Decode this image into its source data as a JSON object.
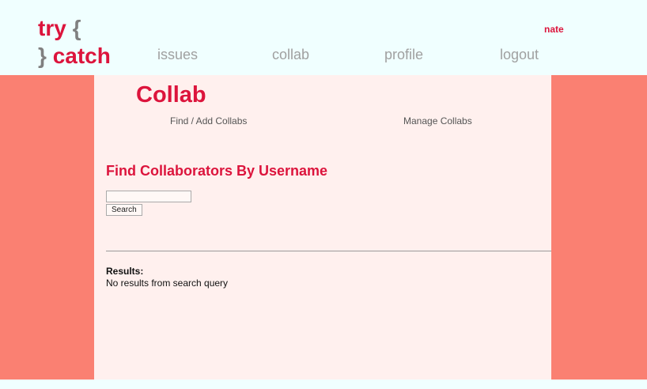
{
  "header": {
    "logo": {
      "word1": "try",
      "brace_open": "{",
      "brace_close": "}",
      "word2": "catch"
    },
    "nav": [
      {
        "label": "issues"
      },
      {
        "label": "collab"
      },
      {
        "label": "profile"
      },
      {
        "label": "logout"
      }
    ],
    "username": "nate"
  },
  "page": {
    "title": "Collab",
    "subnav": [
      {
        "label": "Find / Add Collabs"
      },
      {
        "label": "Manage Collabs"
      }
    ],
    "section_title": "Find Collaborators By Username",
    "search": {
      "value": "",
      "placeholder": "",
      "button_label": "Search"
    },
    "results": {
      "label": "Results:",
      "message": "No results from search query"
    }
  },
  "colors": {
    "accent": "#dc143c",
    "header_bg": "#f0ffff",
    "side_bg": "#fa8072",
    "content_bg": "#fff0ee",
    "nav_text": "#a0a0a0"
  }
}
